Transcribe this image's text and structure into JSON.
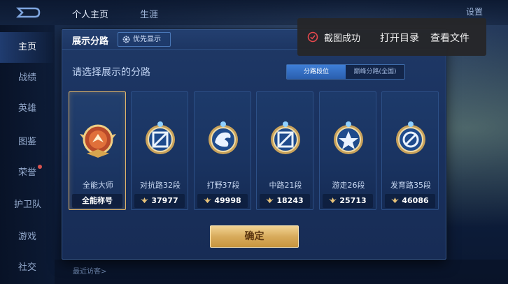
{
  "top": {
    "tabs": [
      "个人主页",
      "生涯"
    ],
    "settings_label": "设置"
  },
  "sidebar": {
    "items": [
      "主页",
      "战绩",
      "英雄",
      "图鉴",
      "荣誉",
      "护卫队",
      "游戏",
      "社交"
    ]
  },
  "visitor_text": "最近访客>",
  "dialog": {
    "title": "展示分路",
    "priority_button": "优先显示",
    "subtitle": "请选择展示的分路",
    "segment": {
      "active": "分路段位",
      "inactive": "巅峰分路(全国)"
    },
    "cards": [
      {
        "name": "全能大师",
        "footer": "全能称号",
        "selected": true,
        "icon": "all-round-badge-icon"
      },
      {
        "name": "对抗路32段",
        "footer": "37977",
        "selected": false,
        "icon": "clash-lane-badge-icon"
      },
      {
        "name": "打野37段",
        "footer": "49998",
        "selected": false,
        "icon": "jungle-badge-icon"
      },
      {
        "name": "中路21段",
        "footer": "18243",
        "selected": false,
        "icon": "mid-lane-badge-icon"
      },
      {
        "name": "游走26段",
        "footer": "25713",
        "selected": false,
        "icon": "roam-badge-icon"
      },
      {
        "name": "发育路35段",
        "footer": "46086",
        "selected": false,
        "icon": "farm-lane-badge-icon"
      }
    ],
    "confirm_button": "确定"
  },
  "toast": {
    "message": "截图成功",
    "open_folder": "打开目录",
    "view_file": "查看文件"
  },
  "colors": {
    "accent_gold": "#e0b56a",
    "dialog_bg": "#1a3260",
    "toast_bg": "#262628",
    "success_red": "#e5484d"
  }
}
